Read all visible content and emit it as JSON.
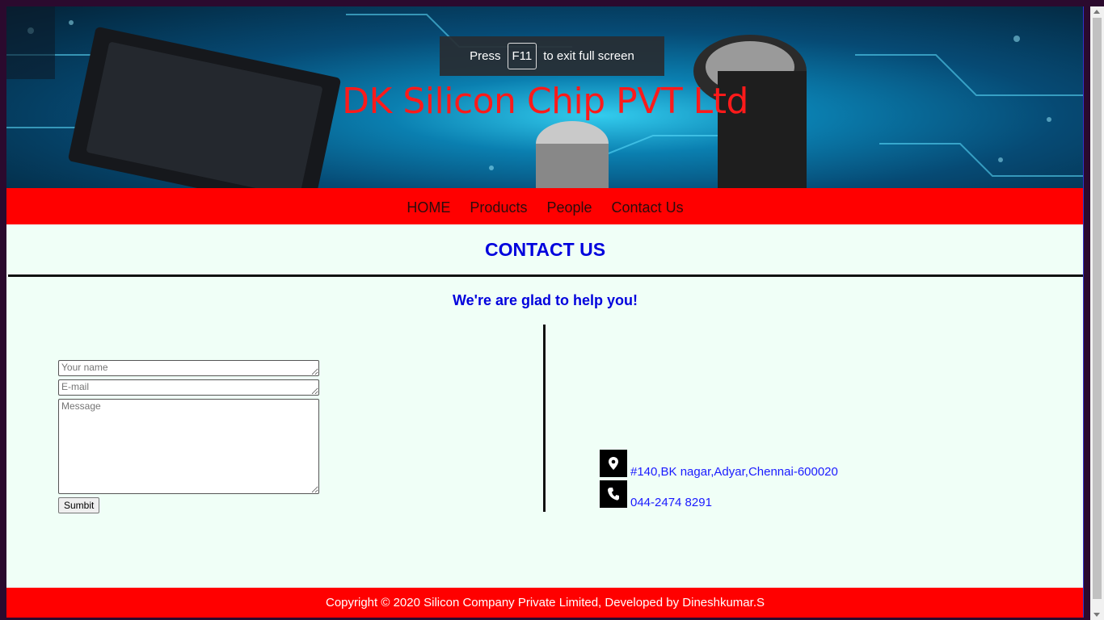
{
  "banner": {
    "title": "DK Silicon Chip PVT Ltd",
    "image_icon": "circuit-board-image"
  },
  "fullscreen_toast": {
    "prefix": "Press",
    "key": "F11",
    "suffix": "to exit full screen"
  },
  "nav": {
    "items": [
      {
        "label": "HOME"
      },
      {
        "label": "Products"
      },
      {
        "label": "People"
      },
      {
        "label": "Contact Us"
      }
    ]
  },
  "main": {
    "heading": "CONTACT US",
    "subheading": "We're are glad to help you!"
  },
  "form": {
    "name_placeholder": "Your name",
    "email_placeholder": "E-mail",
    "message_placeholder": "Message",
    "submit_label": "Sumbit"
  },
  "contact": {
    "address": "#140,BK nagar,Adyar,Chennai-600020",
    "address_icon": "location-pin-icon",
    "phone": "044-2474 8291",
    "phone_icon": "phone-icon"
  },
  "footer": {
    "text": "Copyright © 2020 Silicon Company Private Limited, Developed by Dineshkumar.S"
  },
  "colors": {
    "accent_red": "#ff0000",
    "heading_blue": "#0000dd",
    "page_bg": "#f0fff7"
  }
}
